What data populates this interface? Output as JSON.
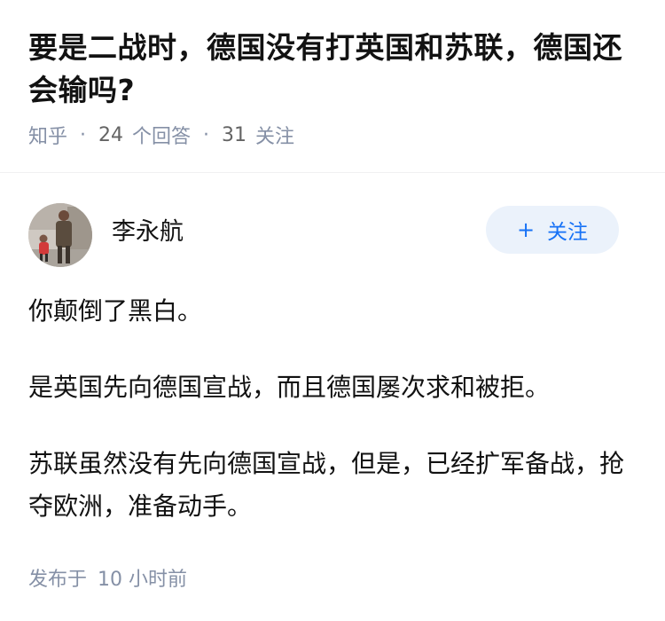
{
  "question": {
    "title": "要是二战时，德国没有打英国和苏联，德国还会输吗?",
    "source": "知乎",
    "answers_count": "24",
    "answers_label": "个回答",
    "follow_count": "31",
    "follow_label": "关注"
  },
  "answer": {
    "author_name": "李永航",
    "follow_button": "关注",
    "follow_icon": "+",
    "paragraphs": [
      "你颠倒了黑白。",
      "是英国先向德国宣战，而且德国屡次求和被拒。",
      "苏联虽然没有先向德国宣战，但是，已经扩军备战，抢夺欧洲，准备动手。"
    ],
    "published_label": "发布于",
    "published_time": "10 小时前"
  },
  "colors": {
    "meta_gray": "#8590a6",
    "follow_blue": "#1772f6",
    "follow_bg": "#ebf2fb"
  }
}
